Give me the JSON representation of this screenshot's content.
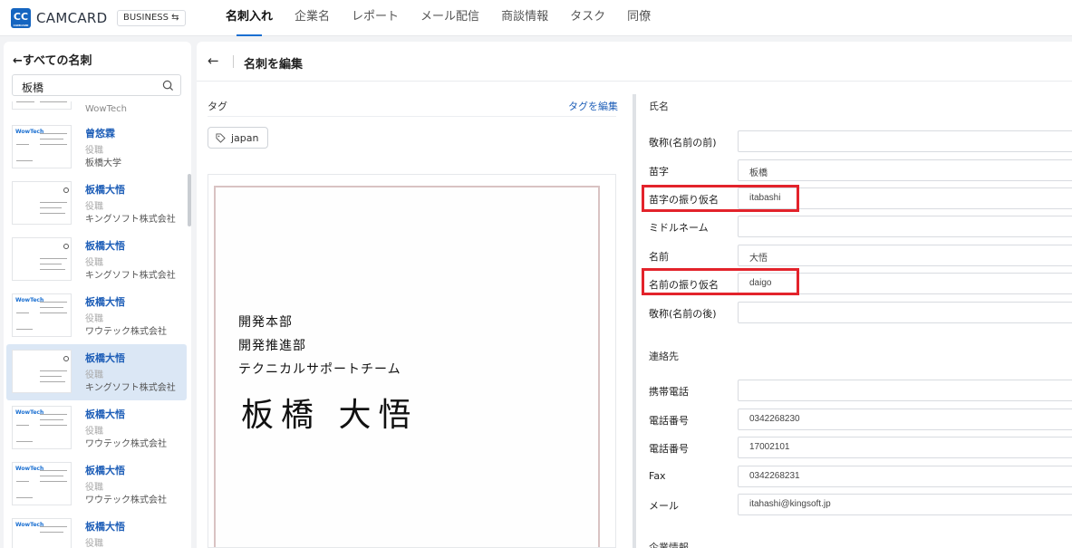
{
  "topbar": {
    "logo": "CC",
    "logo_small": "CAMCARD",
    "brand": "CAMCARD",
    "business_badge": "BUSINESS ⇆",
    "nav": [
      "名刺入れ",
      "企業名",
      "レポート",
      "メール配信",
      "商談情報",
      "タスク",
      "同僚"
    ],
    "active_nav": "名刺入れ"
  },
  "sidebar": {
    "back_label": "すべての名刺",
    "search_value": "板橋",
    "items": [
      {
        "name": "WowTech",
        "title": "",
        "company": "",
        "logo": "WowTech"
      },
      {
        "name": "曾悠霖",
        "title": "役職",
        "company": "板橋大学",
        "logo": "WowTech"
      },
      {
        "name": "板橋大悟",
        "title": "役職",
        "company": "キングソフト株式会社",
        "logo": ""
      },
      {
        "name": "板橋大悟",
        "title": "役職",
        "company": "キングソフト株式会社",
        "logo": ""
      },
      {
        "name": "板橋大悟",
        "title": "役職",
        "company": "ワウテック株式会社",
        "logo": "WowTech"
      },
      {
        "name": "板橋大悟",
        "title": "役職",
        "company": "キングソフト株式会社",
        "logo": "",
        "selected": true
      },
      {
        "name": "板橋大悟",
        "title": "役職",
        "company": "ワウテック株式会社",
        "logo": "WowTech"
      },
      {
        "name": "板橋大悟",
        "title": "役職",
        "company": "ワウテック株式会社",
        "logo": "WowTech"
      },
      {
        "name": "板橋大悟",
        "title": "役職",
        "company": "",
        "logo": "WowTech"
      }
    ]
  },
  "main": {
    "title": "名刺を編集",
    "tag_label": "タグ",
    "tag_edit": "タグを編集",
    "tags": [
      "japan"
    ],
    "card_image": {
      "lines": [
        "開発本部",
        "開発推進部",
        "テクニカルサポートチーム"
      ],
      "name": "板橋 大悟"
    }
  },
  "form": {
    "name_section": "氏名",
    "contact_section": "連絡先",
    "company_section": "企業情報",
    "name_fields": [
      {
        "label": "敬称(名前の前)",
        "value": ""
      },
      {
        "label": "苗字",
        "value": "板橋"
      },
      {
        "label": "苗字の振り仮名",
        "value": "itabashi",
        "highlight": true
      },
      {
        "label": "ミドルネーム",
        "value": ""
      },
      {
        "label": "名前",
        "value": "大悟"
      },
      {
        "label": "名前の振り仮名",
        "value": "daigo",
        "highlight": true
      },
      {
        "label": "敬称(名前の後)",
        "value": ""
      }
    ],
    "contact_fields": [
      {
        "label": "携帯電話",
        "value": ""
      },
      {
        "label": "電話番号",
        "value": "0342268230"
      },
      {
        "label": "電話番号",
        "value": "17002101"
      },
      {
        "label": "Fax",
        "value": "0342268231"
      },
      {
        "label": "メール",
        "value": "itahashi@kingsoft.jp"
      }
    ]
  },
  "colors": {
    "accent": "#1a6fd1",
    "link": "#1f5fb8",
    "highlight": "#e3232b",
    "selected_bg": "#dbe7f5"
  }
}
